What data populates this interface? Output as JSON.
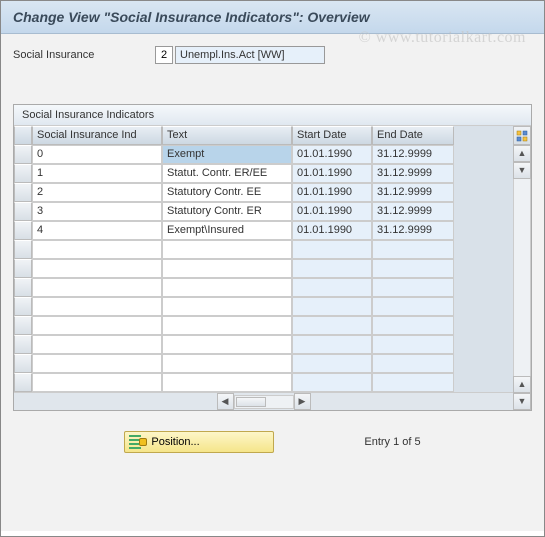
{
  "header": {
    "title": "Change View \"Social Insurance Indicators\": Overview"
  },
  "watermark": "www.tutorialkart.com",
  "field": {
    "label": "Social Insurance",
    "code": "2",
    "text": "Unempl.Ins.Act [WW]"
  },
  "table": {
    "title": "Social Insurance Indicators",
    "columns": {
      "ind": "Social Insurance Ind",
      "text": "Text",
      "start": "Start Date",
      "end": "End Date"
    },
    "rows": [
      {
        "ind": "0",
        "text": "Exempt",
        "start": "01.01.1990",
        "end": "31.12.9999"
      },
      {
        "ind": "1",
        "text": "Statut. Contr. ER/EE",
        "start": "01.01.1990",
        "end": "31.12.9999"
      },
      {
        "ind": "2",
        "text": "Statutory Contr. EE",
        "start": "01.01.1990",
        "end": "31.12.9999"
      },
      {
        "ind": "3",
        "text": "Statutory Contr. ER",
        "start": "01.01.1990",
        "end": "31.12.9999"
      },
      {
        "ind": "4",
        "text": "Exempt\\Insured",
        "start": "01.01.1990",
        "end": "31.12.9999"
      }
    ]
  },
  "footer": {
    "position_label": "Position...",
    "entry_text": "Entry 1 of 5"
  }
}
